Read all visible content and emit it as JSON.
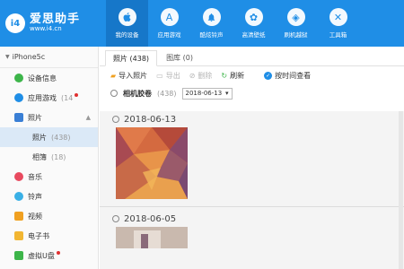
{
  "app": {
    "logo_badge": "i4",
    "logo_title": "爱思助手",
    "logo_url": "www.i4.cn"
  },
  "nav": [
    {
      "label": "我的设备",
      "icon": "apple-icon",
      "glyph": ""
    },
    {
      "label": "应用游戏",
      "icon": "app-store-icon",
      "glyph": "A"
    },
    {
      "label": "酷炫铃声",
      "icon": "bell-icon",
      "glyph": "♪"
    },
    {
      "label": "高清壁纸",
      "icon": "flower-icon",
      "glyph": "✿"
    },
    {
      "label": "刷机越狱",
      "icon": "dropbox-icon",
      "glyph": "◈"
    },
    {
      "label": "工具箱",
      "icon": "tools-icon",
      "glyph": "✕"
    }
  ],
  "sidebar": {
    "device": "iPhone5c",
    "items": [
      {
        "label": "设备信息",
        "count": "",
        "color": "#3db54a"
      },
      {
        "label": "应用游戏",
        "count": "(14",
        "color": "#1f8ee6"
      },
      {
        "label": "照片",
        "count": "",
        "color": "#3a7fd5"
      },
      {
        "label": "照片",
        "count": "(438)"
      },
      {
        "label": "相簿",
        "count": "(18)"
      },
      {
        "label": "音乐",
        "count": "",
        "color": "#e84a5f"
      },
      {
        "label": "铃声",
        "count": "",
        "color": "#3ab0e6"
      },
      {
        "label": "视频",
        "count": "",
        "color": "#f0a020"
      },
      {
        "label": "电子书",
        "count": "",
        "color": "#f2b632"
      },
      {
        "label": "虚拟U盘",
        "count": "",
        "color": "#3db54a"
      }
    ]
  },
  "main": {
    "tabs": [
      "照片 (438)",
      "图库 (0)"
    ],
    "toolbar": {
      "import": "导入照片",
      "export": "导出",
      "delete": "删除",
      "refresh": "刷新",
      "sort": "按时间查看"
    },
    "filter": {
      "album": "相机胶卷",
      "album_count": "(438)",
      "date_value": "2018-06-13"
    },
    "groups": [
      {
        "date": "2018-06-13"
      },
      {
        "date": "2018-06-05"
      }
    ]
  }
}
